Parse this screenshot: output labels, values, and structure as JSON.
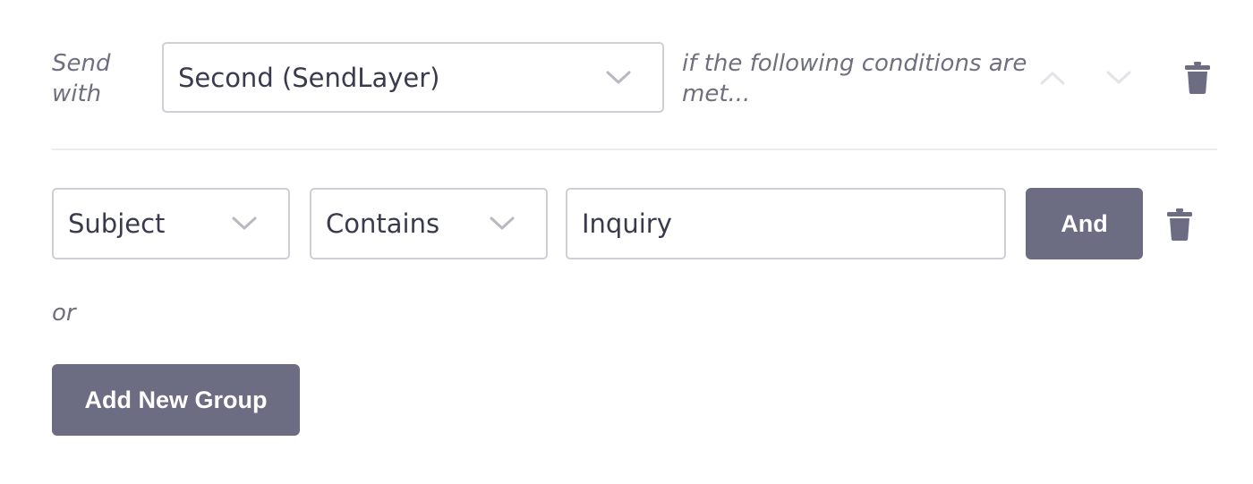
{
  "rule": {
    "send_with_label": "Send with",
    "send_with_line1": "Send",
    "send_with_line2": "with",
    "connection_select": {
      "value": "Second (SendLayer)"
    },
    "conditions_text": "if the following conditions are met...",
    "conditions_line1": "if the following conditions are",
    "conditions_line2": "met..."
  },
  "condition_row": {
    "field_select": {
      "value": "Subject"
    },
    "operator_select": {
      "value": "Contains"
    },
    "value_input": {
      "value": "Inquiry"
    },
    "and_button_label": "And"
  },
  "or_label": "or",
  "add_group_button_label": "Add New Group",
  "icons": {
    "move_up": "chevron-up-icon",
    "move_down": "chevron-down-icon",
    "delete": "trash-icon",
    "dropdown": "chevron-down-icon"
  },
  "colors": {
    "button": "#6c6c83",
    "icon": "#6c6c83",
    "disabled_icon": "#e3e3e8",
    "border": "#cfcfd6",
    "label": "#6f6f80"
  }
}
